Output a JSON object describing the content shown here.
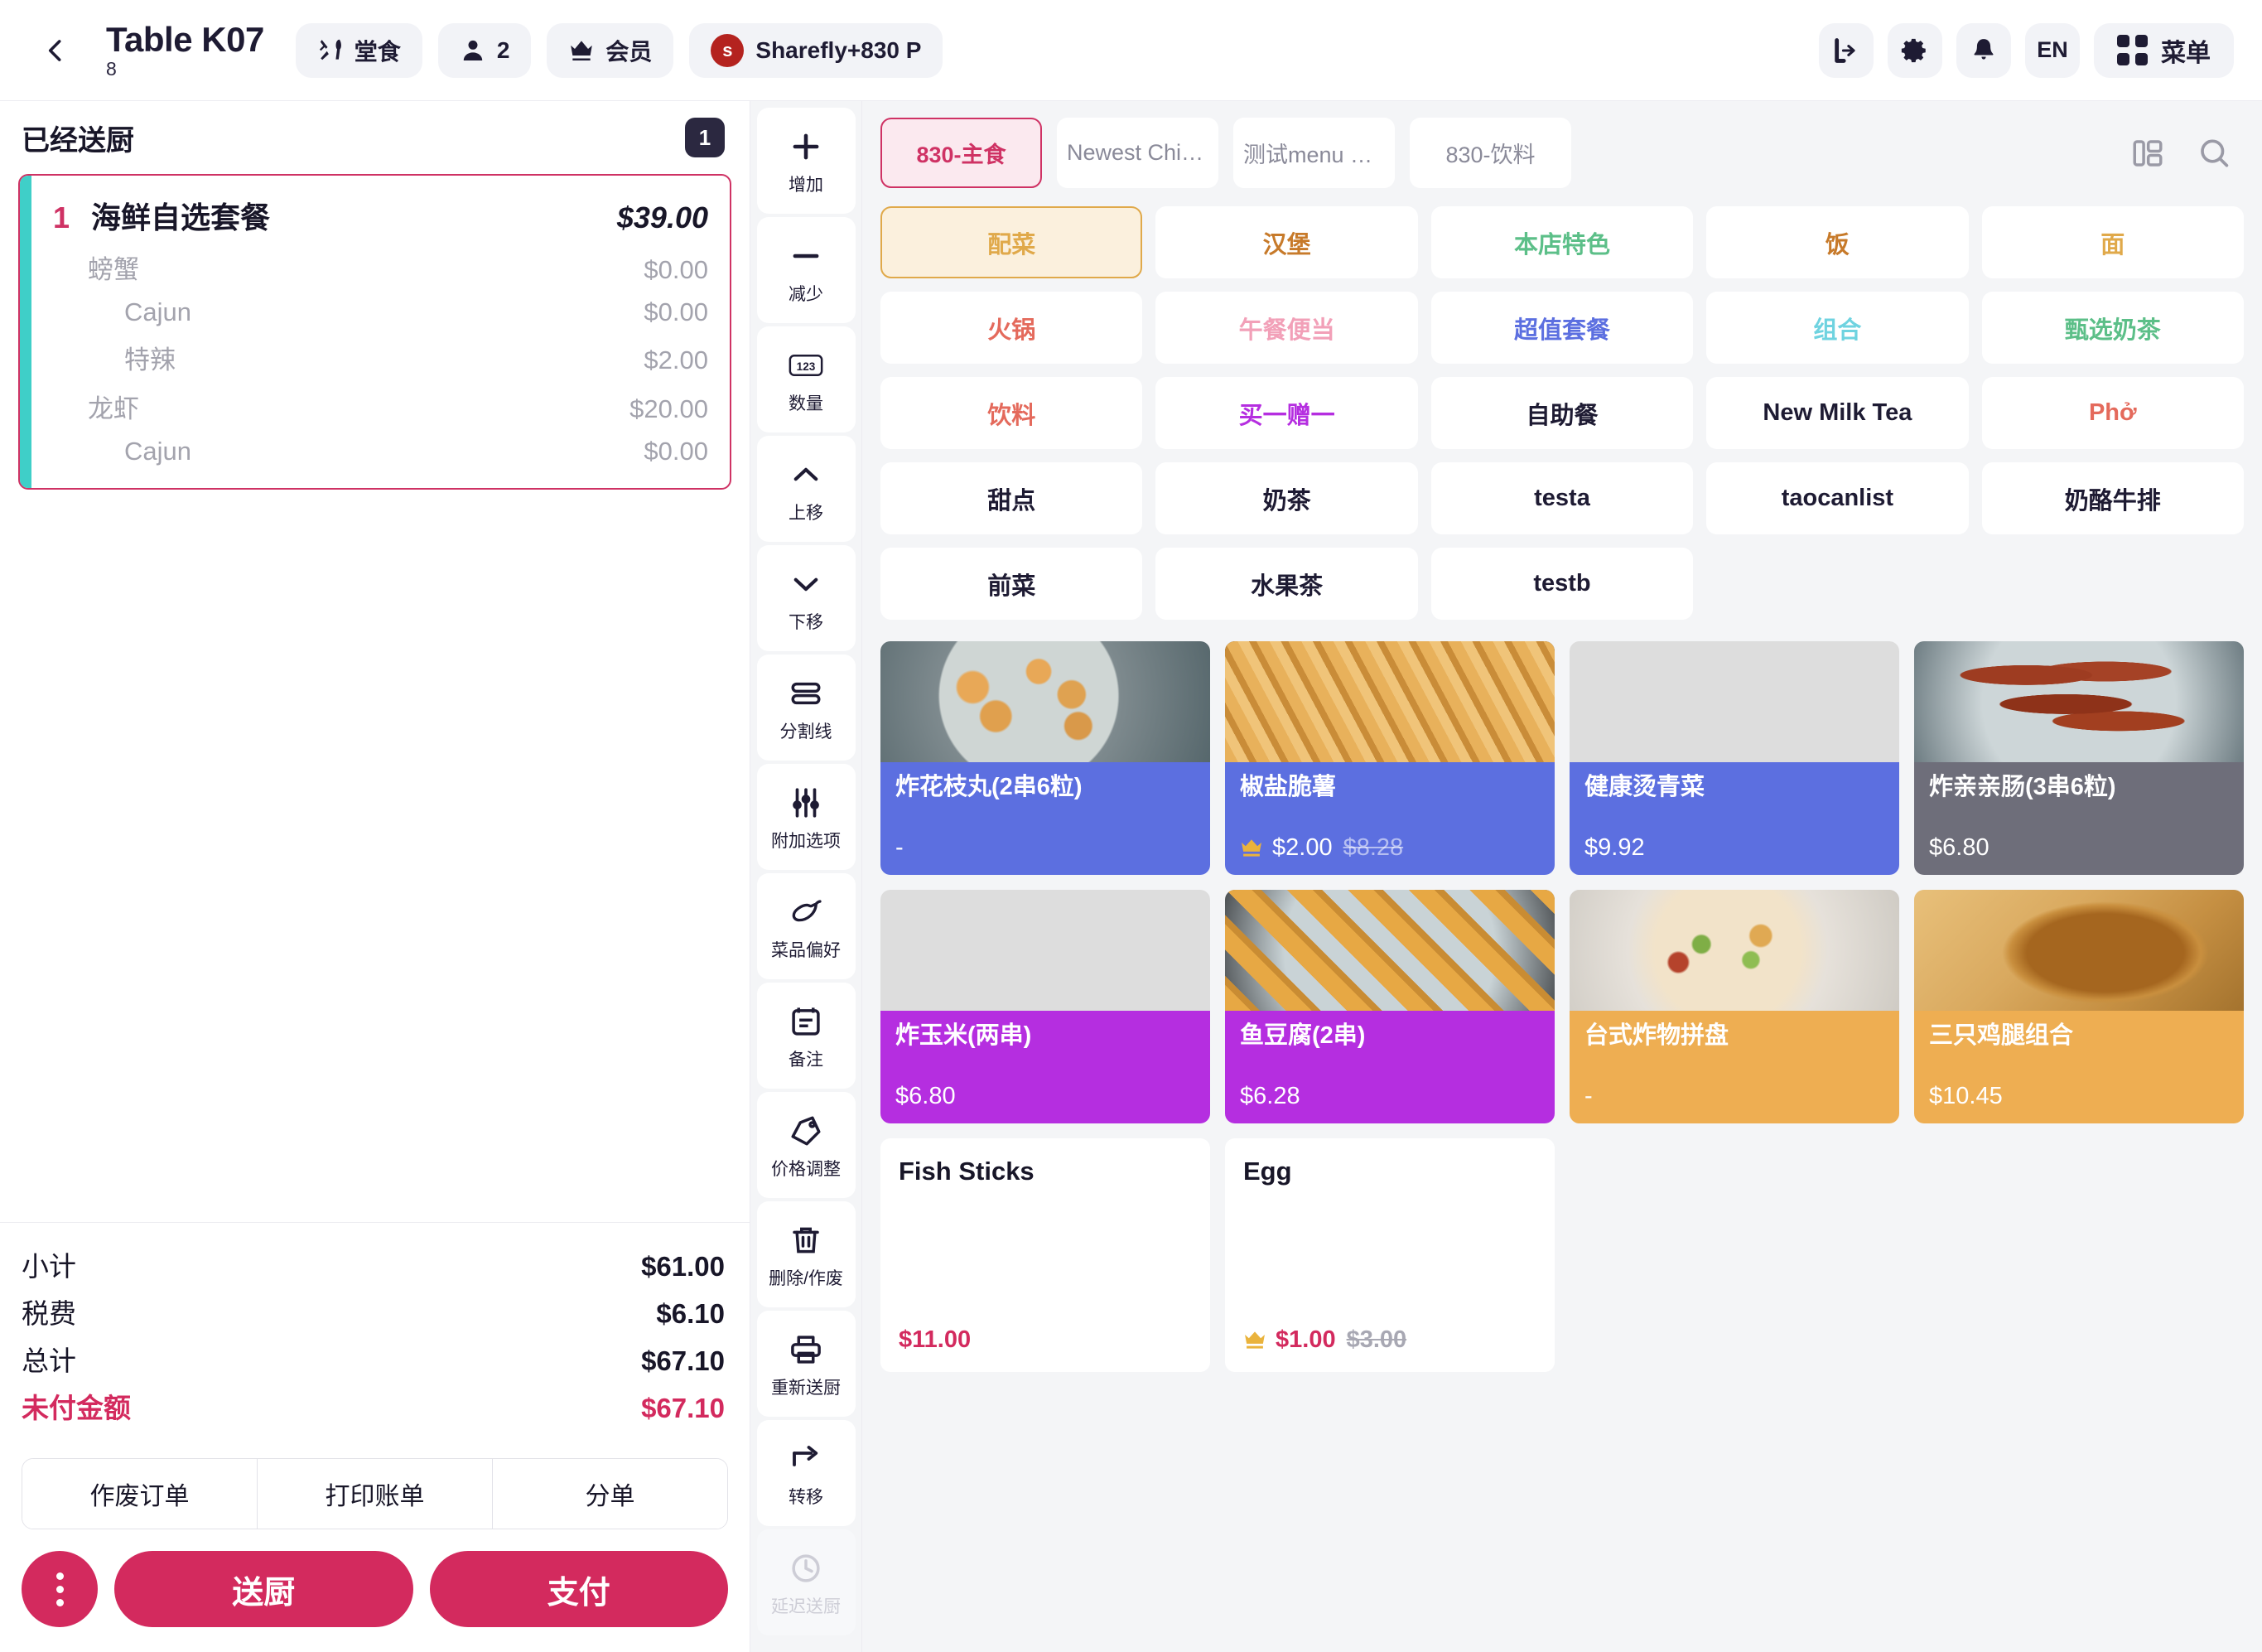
{
  "header": {
    "back_icon": "chevron-left-icon",
    "table_title": "Table K07",
    "table_sub": "8",
    "chips": [
      {
        "icon": "cutlery-icon",
        "label": "堂食"
      },
      {
        "icon": "person-icon",
        "label": "2"
      },
      {
        "icon": "crown-icon",
        "label": "会员"
      }
    ],
    "member": {
      "avatar_letter": "s",
      "label": "Sharefly+830 P"
    },
    "actions": [
      {
        "icon": "logout-icon",
        "label": ""
      },
      {
        "icon": "gear-icon",
        "label": ""
      },
      {
        "icon": "bell-icon",
        "label": ""
      },
      {
        "icon": "language-icon",
        "label": "EN"
      }
    ],
    "menu_button": {
      "icon": "grid-icon",
      "label": "菜单"
    }
  },
  "order": {
    "status_title": "已经送厨",
    "count_badge": "1",
    "items": [
      {
        "qty": "1",
        "name": "海鲜自选套餐",
        "price": "$39.00",
        "options": [
          {
            "level": 1,
            "name": "螃蟹",
            "price": "$0.00"
          },
          {
            "level": 2,
            "name": "Cajun",
            "price": "$0.00"
          },
          {
            "level": 2,
            "name": "特辣",
            "price": "$2.00"
          },
          {
            "level": 1,
            "name": "龙虾",
            "price": "$20.00"
          },
          {
            "level": 2,
            "name": "Cajun",
            "price": "$0.00"
          }
        ]
      }
    ],
    "totals": [
      {
        "label": "小计",
        "value": "$61.00",
        "due": false
      },
      {
        "label": "税费",
        "value": "$6.10",
        "due": false
      },
      {
        "label": "总计",
        "value": "$67.10",
        "due": false
      },
      {
        "label": "未付金额",
        "value": "$67.10",
        "due": true
      }
    ],
    "secondary_buttons": [
      "作废订单",
      "打印账单",
      "分单"
    ],
    "more_button_icon": "more-vertical-icon",
    "primary_buttons": [
      "送厨",
      "支付"
    ]
  },
  "toolbar": [
    {
      "icon": "plus-icon",
      "label": "增加",
      "disabled": false
    },
    {
      "icon": "minus-icon",
      "label": "减少",
      "disabled": false
    },
    {
      "icon": "number-123-icon",
      "label": "数量",
      "disabled": false
    },
    {
      "icon": "chevron-up-icon",
      "label": "上移",
      "disabled": false
    },
    {
      "icon": "chevron-down-icon",
      "label": "下移",
      "disabled": false
    },
    {
      "icon": "divider-icon",
      "label": "分割线",
      "disabled": false
    },
    {
      "icon": "sliders-icon",
      "label": "附加选项",
      "disabled": false
    },
    {
      "icon": "chili-pepper-icon",
      "label": "菜品偏好",
      "disabled": false
    },
    {
      "icon": "note-icon",
      "label": "备注",
      "disabled": false
    },
    {
      "icon": "price-tag-icon",
      "label": "价格调整",
      "disabled": false
    },
    {
      "icon": "trash-icon",
      "label": "删除/作废",
      "disabled": false
    },
    {
      "icon": "printer-icon",
      "label": "重新送厨",
      "disabled": false
    },
    {
      "icon": "arrow-transfer-icon",
      "label": "转移",
      "disabled": false
    },
    {
      "icon": "clock-icon",
      "label": "延迟送厨",
      "disabled": true
    }
  ],
  "menu": {
    "tabs": [
      {
        "label": "830-主食",
        "active": true
      },
      {
        "label": "Newest Chinese...",
        "active": false
      },
      {
        "label": "测试menu 测试",
        "active": false
      },
      {
        "label": "830-饮料",
        "active": false
      }
    ],
    "tab_icons": [
      {
        "icon": "layout-toggle-icon"
      },
      {
        "icon": "search-icon"
      }
    ],
    "categories": [
      {
        "label": "配菜",
        "color": "#e0a94a",
        "active": true
      },
      {
        "label": "汉堡",
        "color": "#c77a2a",
        "active": false
      },
      {
        "label": "本店特色",
        "color": "#5cbf88",
        "active": false
      },
      {
        "label": "饭",
        "color": "#c77a2a",
        "active": false
      },
      {
        "label": "面",
        "color": "#e0a94a",
        "active": false
      },
      {
        "label": "火锅",
        "color": "#e46a5c",
        "active": false
      },
      {
        "label": "午餐便当",
        "color": "#f2a0b8",
        "active": false
      },
      {
        "label": "超值套餐",
        "color": "#5c6fe0",
        "active": false
      },
      {
        "label": "组合",
        "color": "#6fd3e0",
        "active": false
      },
      {
        "label": "甄选奶茶",
        "color": "#5cbf88",
        "active": false
      },
      {
        "label": "饮料",
        "color": "#e46a5c",
        "active": false
      },
      {
        "label": "买一赠一",
        "color": "#b52ee0",
        "active": false
      },
      {
        "label": "自助餐",
        "color": "#1e1b33",
        "active": false
      },
      {
        "label": "New Milk Tea",
        "color": "#1e1b33",
        "active": false
      },
      {
        "label": "Phở",
        "color": "#e46a5c",
        "active": false
      },
      {
        "label": "甜点",
        "color": "#1e1b33",
        "active": false
      },
      {
        "label": "奶茶",
        "color": "#1e1b33",
        "active": false
      },
      {
        "label": "testa",
        "color": "#1e1b33",
        "active": false
      },
      {
        "label": "taocanlist",
        "color": "#1e1b33",
        "active": false
      },
      {
        "label": "奶酪牛排",
        "color": "#1e1b33",
        "active": false
      },
      {
        "label": "前菜",
        "color": "#1e1b33",
        "active": false
      },
      {
        "label": "水果茶",
        "color": "#1e1b33",
        "active": false
      },
      {
        "label": "testb",
        "color": "#1e1b33",
        "active": false
      }
    ],
    "products": [
      {
        "name": "炸花枝丸(2串6粒)",
        "price": "-",
        "orig_price": "",
        "member": false,
        "band_color": "#5c6fe0",
        "photo": "f1",
        "has_photo": true
      },
      {
        "name": "椒盐脆薯",
        "price": "$2.00",
        "orig_price": "$8.28",
        "member": true,
        "band_color": "#5c6fe0",
        "photo": "f2",
        "has_photo": true
      },
      {
        "name": "健康烫青菜",
        "price": "$9.92",
        "orig_price": "",
        "member": false,
        "band_color": "#5c6fe0",
        "photo": "f3",
        "has_photo": true
      },
      {
        "name": "炸亲亲肠(3串6粒)",
        "price": "$6.80",
        "orig_price": "",
        "member": false,
        "band_color": "#6e6e7a",
        "photo": "f4",
        "has_photo": true
      },
      {
        "name": "炸玉米(两串)",
        "price": "$6.80",
        "orig_price": "",
        "member": false,
        "band_color": "#b52ee0",
        "photo": "f5",
        "has_photo": true
      },
      {
        "name": "鱼豆腐(2串)",
        "price": "$6.28",
        "orig_price": "",
        "member": false,
        "band_color": "#b52ee0",
        "photo": "f6",
        "has_photo": true
      },
      {
        "name": "台式炸物拼盘",
        "price": "-",
        "orig_price": "",
        "member": false,
        "band_color": "#eeae52",
        "photo": "f7",
        "has_photo": true
      },
      {
        "name": "三只鸡腿组合",
        "price": "$10.45",
        "orig_price": "",
        "member": false,
        "band_color": "#eeae52",
        "photo": "f8",
        "has_photo": true
      },
      {
        "name": "Fish Sticks",
        "price": "$11.00",
        "orig_price": "",
        "member": false,
        "band_color": "#ffffff",
        "photo": "",
        "has_photo": false
      },
      {
        "name": "Egg",
        "price": "$1.00",
        "orig_price": "$3.00",
        "member": true,
        "band_color": "#ffffff",
        "photo": "",
        "has_photo": false
      }
    ]
  },
  "colors": {
    "accent": "#d32a5e",
    "tab_active_border": "#cf3264",
    "cat_active_border": "#e0a94a",
    "order_stripe": "#3fcfc8",
    "member_crown": "#eab33c"
  }
}
